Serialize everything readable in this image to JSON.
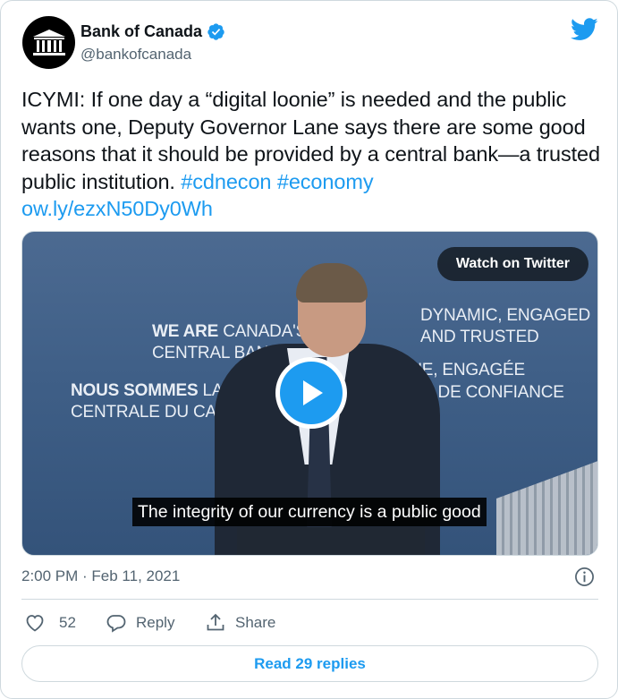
{
  "author": {
    "name": "Bank of Canada",
    "handle": "@bankofcanada"
  },
  "tweet": {
    "text": "ICYMI: If one day a “digital loonie” is needed and the public wants one, Deputy Governor Lane says there are some good reasons that it should be provided by a central bank—a trusted public institution. ",
    "hashtag1": "#cdnecon",
    "hashtag2": "#economy",
    "link": "ow.ly/ezxN50Dy0Wh"
  },
  "media": {
    "watch_label": "Watch on Twitter",
    "caption": "The integrity of our currency is a public good",
    "background": {
      "line1_bold": "WE ARE",
      "line1_rest": " CANADA'S",
      "line2": "CENTRAL BANK.",
      "line3_bold": "NOUS SOMMES",
      "line3_rest": " LA BAN",
      "line4": "CENTRALE DU CANADA",
      "right1": "DYNAMIC, ENGAGED",
      "right2": "AND TRUSTED",
      "right3": "NAMIQUE, ENGAGÉE",
      "right4": "E DE CONFIANCE"
    }
  },
  "timestamp": "2:00 PM · Feb 11, 2021",
  "actions": {
    "like_count": "52",
    "reply_label": "Reply",
    "share_label": "Share"
  },
  "read_replies_label": "Read 29 replies",
  "colors": {
    "accent": "#1d9bf0",
    "secondary_text": "#536471",
    "border": "#cfd9de"
  },
  "icons": [
    "bank-logo-icon",
    "verified-badge-icon",
    "twitter-bird-icon",
    "play-icon",
    "info-icon",
    "heart-icon",
    "reply-icon",
    "share-icon"
  ]
}
